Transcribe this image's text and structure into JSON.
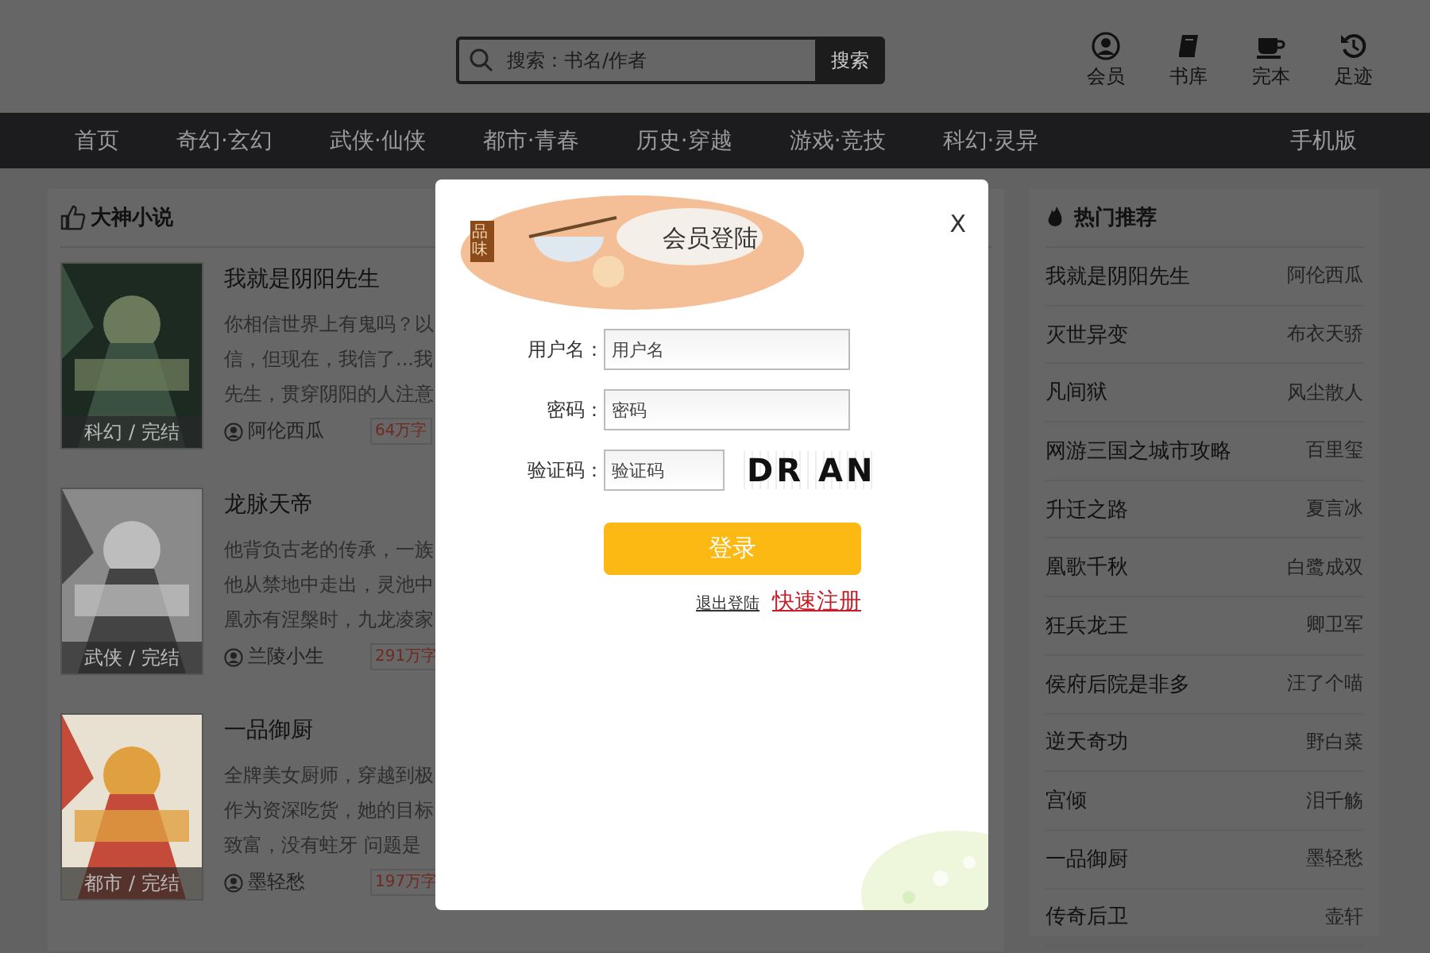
{
  "header": {
    "search": {
      "placeholder": "搜索：书名/作者",
      "button": "搜索"
    },
    "links": [
      {
        "label": "会员",
        "kind": "user"
      },
      {
        "label": "书库",
        "kind": "book"
      },
      {
        "label": "完本",
        "kind": "cup"
      },
      {
        "label": "足迹",
        "kind": "history"
      }
    ]
  },
  "nav": {
    "items": [
      {
        "label": "首页"
      },
      {
        "label": "奇幻·玄幻"
      },
      {
        "label": "武侠·仙侠"
      },
      {
        "label": "都市·青春"
      },
      {
        "label": "历史·穿越"
      },
      {
        "label": "游戏·竞技"
      },
      {
        "label": "科幻·灵异"
      }
    ],
    "mobile": "手机版"
  },
  "featured": {
    "title": "大神小说",
    "books": [
      {
        "title": "我就是阴阳先生",
        "cover_caption": "科幻 / 完结",
        "description": [
          "你相信世界上有鬼吗？以",
          "信，但现在，我信了...我",
          "先生，贯穿阴阳的人注意"
        ],
        "author": "阿伦西瓜",
        "words": "64万字"
      },
      {
        "title": "龙脉天帝",
        "cover_caption": "武侠 / 完结",
        "description": [
          "他背负古老的传承，一族",
          "他从禁地中走出，灵池中",
          "凰亦有涅槃时，九龙凌家"
        ],
        "author": "兰陵小生",
        "words": "291万字"
      },
      {
        "title": "一品御厨",
        "cover_caption": "都市 / 完结",
        "description": [
          "全牌美女厨师，穿越到极",
          "作为资深吃货，她的目标",
          "致富，没有蛀牙 问题是"
        ],
        "author": "墨轻愁",
        "words": "197万字"
      }
    ]
  },
  "hot": {
    "title": "热门推荐",
    "rows": [
      {
        "title": "我就是阴阳先生",
        "author": "阿伦西瓜"
      },
      {
        "title": "灭世异变",
        "author": "布衣天骄"
      },
      {
        "title": "凡间狱",
        "author": "风尘散人"
      },
      {
        "title": "网游三国之城市攻略",
        "author": "百里玺"
      },
      {
        "title": "升迁之路",
        "author": "夏言冰"
      },
      {
        "title": "凰歌千秋",
        "author": "白鹭成双"
      },
      {
        "title": "狂兵龙王",
        "author": "卿卫军"
      },
      {
        "title": "侯府后院是非多",
        "author": "汪了个喵"
      },
      {
        "title": "逆天奇功",
        "author": "野白菜"
      },
      {
        "title": "宫倾",
        "author": "泪千觞"
      },
      {
        "title": "一品御厨",
        "author": "墨轻愁"
      },
      {
        "title": "传奇后卫",
        "author": "壶轩"
      }
    ]
  },
  "login": {
    "badge": "品味",
    "title": "会员登陆",
    "close": "X",
    "fields": [
      {
        "label": "用户名：",
        "placeholder": "用户名",
        "kind": "text"
      },
      {
        "label": "密码：",
        "placeholder": "密码",
        "kind": "password"
      },
      {
        "label": "验证码：",
        "placeholder": "验证码",
        "kind": "captcha"
      }
    ],
    "captcha": "DR AN",
    "submit": "登录",
    "logout": "退出登陆",
    "register": "快速注册"
  }
}
